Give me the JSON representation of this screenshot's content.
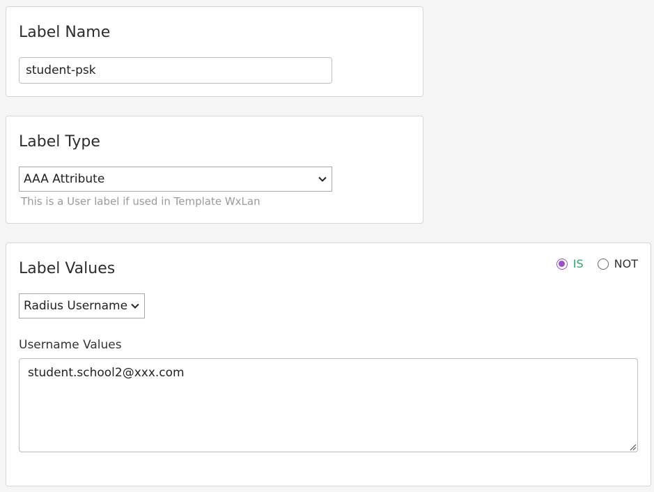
{
  "label_name": {
    "title": "Label Name",
    "value": "student-psk"
  },
  "label_type": {
    "title": "Label Type",
    "selected": "AAA Attribute",
    "helper": "This is a User label if used in Template WxLan"
  },
  "label_values": {
    "title": "Label Values",
    "match": {
      "is_label": "IS",
      "not_label": "NOT",
      "selected": "IS"
    },
    "attribute_selected": "Radius Username",
    "field_label": "Username Values",
    "values_text": "student.school2@xxx.com"
  },
  "colors": {
    "radio_accent": "#9b4fc7",
    "is_text": "#2aa86a"
  }
}
